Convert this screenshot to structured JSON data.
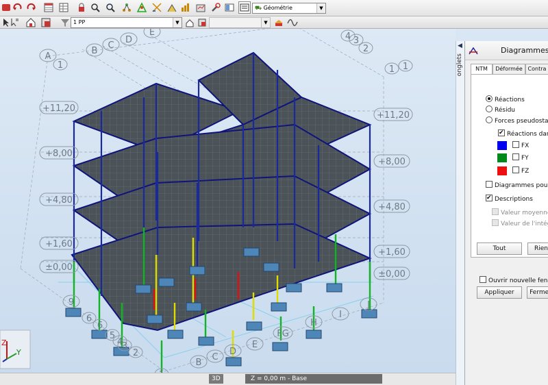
{
  "toolbar": {
    "icons": [
      "undo-icon",
      "undo-arrow-icon",
      "redo-arrow-icon",
      "spreadsheet-icon",
      "table-icon",
      "lock-icon",
      "zoom-icon",
      "zoom-window-icon",
      "hierarchy-icon",
      "model-icon",
      "structure-icon",
      "calculator-icon",
      "graph-icon",
      "settings-icon",
      "tools-icon",
      "layout-icon",
      "view-icon"
    ],
    "layout_combo": "Géométrie",
    "group_combo": "1 PP",
    "row2_icons": [
      "pointer-icon",
      "select-icon",
      "house-icon",
      "frame-icon",
      "filter-icon"
    ],
    "right_combo": ""
  },
  "viewport": {
    "level_labels": {
      "left": [
        "+11,20",
        "+8,00",
        "+4,80",
        "+1,60",
        "±0,00"
      ],
      "right": [
        "+11,20",
        "+8,00",
        "+4,80",
        "+1,60",
        "±0,00"
      ]
    },
    "axis_letters_top": [
      "A",
      "B",
      "C",
      "D",
      "E"
    ],
    "axis_numbers_top_left": [
      "1"
    ],
    "axis_numbers_top_right": [
      "1",
      "1",
      "2",
      "3",
      "4"
    ],
    "axis_letters_bottom": [
      "B",
      "C",
      "D",
      "E",
      "FG",
      "H",
      "I",
      "J"
    ],
    "axis_numbers_bottom": [
      "9",
      "6",
      "6",
      "5",
      "4",
      "3",
      "2",
      "1"
    ],
    "axes_triad": {
      "z": "Z",
      "y": "Y"
    }
  },
  "sidetab": {
    "label": "onglets"
  },
  "panel": {
    "title": "Diagrammes",
    "tabs": [
      "NTM",
      "Déformée",
      "Contra"
    ],
    "options": {
      "reactions": "Réactions",
      "residu": "Résidu",
      "forces": "Forces pseudostatiques",
      "reactions_dans": "Réactions dans",
      "fx": "FX",
      "fy": "FY",
      "fz": "FZ",
      "diagrammes_pour": "Diagrammes pour les",
      "descriptions": "Descriptions",
      "valeur_moyenne": "Valeur moyenne",
      "valeur_integrale": "Valeur de l'intégrale"
    },
    "colors": {
      "fx": "#0000ee",
      "fy": "#008a1c",
      "fz": "#ee1010"
    },
    "buttons": {
      "tout": "Tout",
      "rien": "Rien",
      "appliquer": "Appliquer",
      "fermer": "Fermer"
    },
    "new_window": "Ouvrir nouvelle fenêtre"
  },
  "status": {
    "view": "3D",
    "zlevel": "Z = 0,00 m - Base"
  }
}
